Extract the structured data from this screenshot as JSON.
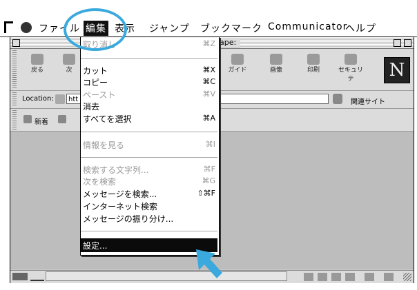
{
  "menubar": {
    "items": [
      {
        "label": "ファイル"
      },
      {
        "label": "編集",
        "selected": true
      },
      {
        "label": "表示"
      },
      {
        "label": "ジャンプ"
      },
      {
        "label": "ブックマーク"
      },
      {
        "label": "Communicator"
      },
      {
        "label": "ヘルプ"
      }
    ]
  },
  "window": {
    "title_fragment": "ape:"
  },
  "toolbar": {
    "buttons": [
      {
        "label": "戻る",
        "icon": "back-icon"
      },
      {
        "label": "次",
        "icon": "forward-icon"
      },
      {
        "label": "ガイド",
        "icon": "guide-icon"
      },
      {
        "label": "画像",
        "icon": "images-icon"
      },
      {
        "label": "印刷",
        "icon": "print-icon"
      },
      {
        "label": "セキュリテ",
        "icon": "security-icon"
      }
    ]
  },
  "location": {
    "label": "Location:",
    "value": "htt",
    "related_sites": "関連サイト"
  },
  "personal": {
    "new_label": "新着"
  },
  "edit_menu": {
    "items": [
      {
        "label": "取り消し",
        "shortcut": "⌘Z",
        "disabled": true
      },
      {
        "label": "カット",
        "shortcut": "⌘X",
        "disabled": false
      },
      {
        "label": "コピー",
        "shortcut": "⌘C",
        "disabled": false
      },
      {
        "label": "ペースト",
        "shortcut": "⌘V",
        "disabled": true
      },
      {
        "label": "消去",
        "shortcut": "",
        "disabled": false
      },
      {
        "label": "すべてを選択",
        "shortcut": "⌘A",
        "disabled": false
      },
      {
        "label": "情報を見る",
        "shortcut": "⌘I",
        "disabled": true
      },
      {
        "label": "検索する文字列...",
        "shortcut": "⌘F",
        "disabled": true
      },
      {
        "label": "次を検索",
        "shortcut": "⌘G",
        "disabled": true
      },
      {
        "label": "メッセージを検索...",
        "shortcut": "⇧⌘F",
        "disabled": false
      },
      {
        "label": "インターネット検索",
        "shortcut": "",
        "disabled": false
      },
      {
        "label": "メッセージの振り分け...",
        "shortcut": "",
        "disabled": false
      },
      {
        "label": "設定...",
        "shortcut": "",
        "disabled": false,
        "highlighted": true
      }
    ]
  },
  "colors": {
    "annotation": "#3aa9dd",
    "menu_highlight": "#0b0b0b"
  }
}
